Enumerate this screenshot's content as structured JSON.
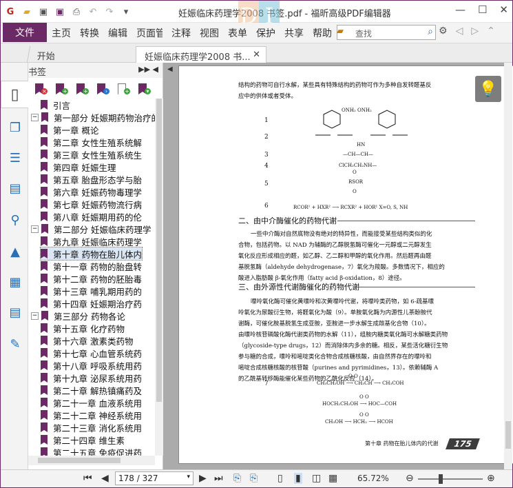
{
  "window": {
    "title": "妊娠临床药理学2008 书签.pdf - 福昕高级PDF编辑器",
    "logo": "DI"
  },
  "menu": {
    "file": "文件",
    "items": [
      "主页",
      "转换",
      "编辑",
      "页面管理",
      "注释",
      "视图",
      "表单",
      "保护",
      "共享",
      "帮助"
    ]
  },
  "search": {
    "placeholder": "查找"
  },
  "tabs": {
    "home": "开始",
    "doc": "妊娠临床药理学2008 书..."
  },
  "panel": {
    "title": "书签"
  },
  "bookmarks": [
    {
      "label": "引言",
      "level": 1,
      "exp": ""
    },
    {
      "label": "第一部分  妊娠期药物治疗的",
      "level": 0,
      "exp": "−"
    },
    {
      "label": "第一章 概论",
      "level": 1,
      "exp": ""
    },
    {
      "label": "第二章 女性生殖系统解",
      "level": 1,
      "exp": ""
    },
    {
      "label": "第三章 女性生殖系统生",
      "level": 1,
      "exp": ""
    },
    {
      "label": "第四章 妊娠生理",
      "level": 1,
      "exp": ""
    },
    {
      "label": "第五章 胎盘形态学与胎",
      "level": 1,
      "exp": ""
    },
    {
      "label": "第六章 妊娠药物毒理学",
      "level": 1,
      "exp": ""
    },
    {
      "label": "第七章 妊娠药物流行病",
      "level": 1,
      "exp": ""
    },
    {
      "label": "第八章 妊娠期用药的伦",
      "level": 1,
      "exp": ""
    },
    {
      "label": "第二部分  妊娠临床药理学",
      "level": 0,
      "exp": "−"
    },
    {
      "label": "第九章 妊娠临床药理学",
      "level": 1,
      "exp": ""
    },
    {
      "label": "第十章 药物在胎儿体内",
      "level": 1,
      "exp": "",
      "selected": true
    },
    {
      "label": "第十一章 药物的胎盘转",
      "level": 1,
      "exp": ""
    },
    {
      "label": "第十二章 药物的胚胎毒",
      "level": 1,
      "exp": ""
    },
    {
      "label": "第十三章 哺乳期用药的",
      "level": 1,
      "exp": ""
    },
    {
      "label": "第十四章 妊娠期治疗药",
      "level": 1,
      "exp": ""
    },
    {
      "label": "第三部分  药物各论",
      "level": 0,
      "exp": "−"
    },
    {
      "label": "第十五章 化疗药物",
      "level": 1,
      "exp": ""
    },
    {
      "label": "第十六章 激素类药物",
      "level": 1,
      "exp": ""
    },
    {
      "label": "第十七章 心血管系统药",
      "level": 1,
      "exp": ""
    },
    {
      "label": "第十八章 呼吸系统用药",
      "level": 1,
      "exp": ""
    },
    {
      "label": "第十九章 泌尿系统用药",
      "level": 1,
      "exp": ""
    },
    {
      "label": "第二十章 解热镇痛药及",
      "level": 1,
      "exp": ""
    },
    {
      "label": "第二十一章 血液系统用",
      "level": 1,
      "exp": ""
    },
    {
      "label": "第二十二章 神经系统用",
      "level": 1,
      "exp": ""
    },
    {
      "label": "第二十三章 消化系统用",
      "level": 1,
      "exp": ""
    },
    {
      "label": "第二十四章 维生素",
      "level": 1,
      "exp": ""
    },
    {
      "label": "第二十五章 免疫促进药",
      "level": 1,
      "exp": ""
    }
  ],
  "doc": {
    "intro": [
      "结构的药物可自行水解，某些具有特殊结构的药物可作为多种自发转醛基反",
      "应中的供体或者受体。"
    ],
    "reactions": [
      "1",
      "2",
      "3",
      "4",
      "5",
      "6"
    ],
    "chem": {
      "r1": "ONH₂    ONH₂",
      "r3": "HN",
      "r3b": "—CH—CH—",
      "r4": "ClCH₂CH₂NH—",
      "r5a": "O",
      "r5b": "RSOR",
      "r5c": "O",
      "r6": "RCOR¹ + HXR² ⟶ RCXR² + HOR¹        X=O, S, NH"
    },
    "h2": "二、由中介酶催化的药物代谢",
    "p2": [
      "一些中介酶对自然底物没有绝对的特异性，而能接受某些结构类似的化",
      "合物，包括药物。以 NAD 为辅酶的乙醇脱氢酶可催化一元醇或二元醇发生",
      "氧化反应形成相应的醛，如乙醇、乙二醇和甲醇的氧化作用。然后醛再由醛",
      "基脱氢酶（aldehyde dehydrogenase，7）氧化为羧酸。多数情况下，相应的",
      "酸进入脂肪酸 β-氧化作用（fatty acid β-oxidation，8）途径。"
    ],
    "h3": "三、由外源性代谢酶催化的药物代谢",
    "p3": [
      "嘌呤氧化酶可催化黄嘌呤和次黄嘌呤代谢，将嘌呤类药物，如 6-疏基嘌",
      "呤氧化为尿酸衍生物，将醛氧化为酸（9）。单胺氧化酶为内源性儿茶酚胺代",
      "谢酶，可催化胺基脱氢生成亚胺，亚胺进一步水解生成羰基化合物（10）。",
      "由嘌呤核苷磷酸化酶代谢类药物的水解（11），组胺内糖类氧化酶可水解糖类药物",
      "（glycoside-type drugs，12）而消除体内多余的糖。相反，某些活化糖衍生物",
      "参与糖的合成，嘌呤和嘧啶类化合物合成核糖核酸，由自然界存在的嘌呤和",
      "嘧啶合成核糖核酸的核苷酸（purines and pyrimidines，13）。依赖辅酶 A",
      "的乙酰基转移酶能催化某些药物的乙酰化反应（14）。"
    ],
    "r7": "7",
    "chem7": [
      "O                    O",
      "CH₃CH₂OH ⟶ CH₃CH ⟶ CH₃COH",
      "O           O",
      "HOCH₂CH₂OH ⟶ HOC—COH",
      "O           O",
      "CH₃OH ⟶ HCH₂ ⟶ HCOH"
    ],
    "footer": "第十章  药物在胎儿体内的代谢",
    "page_no": "175"
  },
  "status": {
    "page": "178 / 327",
    "zoom": "65.72%"
  }
}
